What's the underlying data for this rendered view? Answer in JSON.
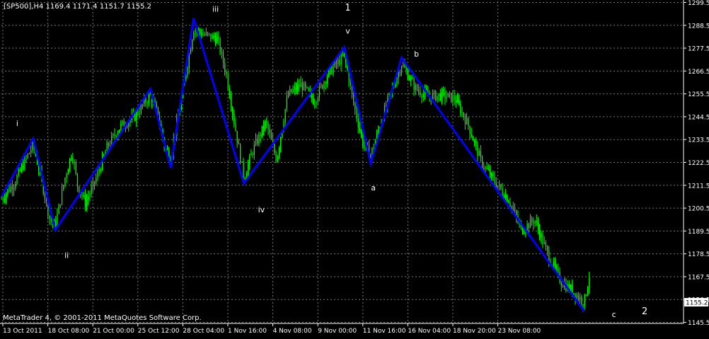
{
  "header": {
    "text": "[SP500],H4  1169.4 1171.4 1151.7 1155.2"
  },
  "copyright": "MetaTrader 4, © 2001-2011 MetaQuotes Software Corp.",
  "colors": {
    "background": "#000000",
    "grid": "#6e7f6e",
    "candles": "#00ff00",
    "wave_line": "#0000ff",
    "text": "#ffffff",
    "price_tag_bg": "#ffffff"
  },
  "chart_data": {
    "type": "line",
    "symbol": "[SP500],H4",
    "ohlc": {
      "open": 1169.4,
      "high": 1171.4,
      "low": 1151.7,
      "close": 1155.2
    },
    "current_price_label": "1155.2",
    "ylim": [
      1145.0,
      1300.0
    ],
    "y_ticks": [
      "1299.5",
      "1288.5",
      "1277.5",
      "1266.5",
      "1255.5",
      "1244.5",
      "1233.5",
      "1222.5",
      "1211.5",
      "1200.5",
      "1189.5",
      "1178.5",
      "1167.5",
      "1156.5",
      "1145.5"
    ],
    "x_ticks": [
      "13 Oct 2011",
      "18 Oct 08:00",
      "21 Oct 00:00",
      "25 Oct 12:00",
      "28 Oct 04:00",
      "1 Nov 16:00",
      "4 Nov 08:00",
      "9 Nov 00:00",
      "11 Nov 16:00",
      "16 Nov 04:00",
      "18 Nov 20:00",
      "23 Nov 08:00"
    ],
    "grid": true,
    "wave_series": {
      "name": "wave count",
      "points": [
        {
          "t": 0.0,
          "y": 1206.0
        },
        {
          "t": 3.6,
          "y": 1234.0
        },
        {
          "t": 6.1,
          "y": 1190.0
        },
        {
          "t": 16.9,
          "y": 1258.0
        },
        {
          "t": 19.2,
          "y": 1220.0
        },
        {
          "t": 21.8,
          "y": 1292.0
        },
        {
          "t": 27.5,
          "y": 1212.5
        },
        {
          "t": 38.9,
          "y": 1278.0
        },
        {
          "t": 41.9,
          "y": 1222.0
        },
        {
          "t": 45.4,
          "y": 1273.0
        },
        {
          "t": 66.1,
          "y": 1151.0
        }
      ]
    },
    "price_path": [
      {
        "t": 0.0,
        "y": 1205.0
      },
      {
        "t": 1.5,
        "y": 1213.0
      },
      {
        "t": 3.6,
        "y": 1231.0
      },
      {
        "t": 4.5,
        "y": 1215.0
      },
      {
        "t": 5.5,
        "y": 1195.0
      },
      {
        "t": 6.1,
        "y": 1192.0
      },
      {
        "t": 7.2,
        "y": 1215.0
      },
      {
        "t": 8.0,
        "y": 1228.0
      },
      {
        "t": 8.6,
        "y": 1212.0
      },
      {
        "t": 9.5,
        "y": 1203.0
      },
      {
        "t": 10.5,
        "y": 1212.0
      },
      {
        "t": 12.0,
        "y": 1230.0
      },
      {
        "t": 13.5,
        "y": 1240.0
      },
      {
        "t": 15.0,
        "y": 1244.0
      },
      {
        "t": 16.9,
        "y": 1255.0
      },
      {
        "t": 17.8,
        "y": 1245.0
      },
      {
        "t": 18.5,
        "y": 1230.0
      },
      {
        "t": 19.2,
        "y": 1225.0
      },
      {
        "t": 20.5,
        "y": 1255.0
      },
      {
        "t": 21.8,
        "y": 1287.0
      },
      {
        "t": 23.0,
        "y": 1284.0
      },
      {
        "t": 24.5,
        "y": 1282.0
      },
      {
        "t": 25.5,
        "y": 1265.0
      },
      {
        "t": 26.5,
        "y": 1240.0
      },
      {
        "t": 27.5,
        "y": 1215.0
      },
      {
        "t": 28.5,
        "y": 1228.0
      },
      {
        "t": 30.0,
        "y": 1242.0
      },
      {
        "t": 31.2,
        "y": 1224.0
      },
      {
        "t": 32.5,
        "y": 1255.0
      },
      {
        "t": 34.0,
        "y": 1260.0
      },
      {
        "t": 35.5,
        "y": 1252.0
      },
      {
        "t": 37.0,
        "y": 1265.0
      },
      {
        "t": 38.9,
        "y": 1274.0
      },
      {
        "t": 40.0,
        "y": 1250.0
      },
      {
        "t": 41.0,
        "y": 1232.0
      },
      {
        "t": 41.9,
        "y": 1226.0
      },
      {
        "t": 43.5,
        "y": 1248.0
      },
      {
        "t": 45.4,
        "y": 1270.0
      },
      {
        "t": 47.0,
        "y": 1258.0
      },
      {
        "t": 48.5,
        "y": 1254.0
      },
      {
        "t": 50.0,
        "y": 1255.0
      },
      {
        "t": 51.5,
        "y": 1253.0
      },
      {
        "t": 53.0,
        "y": 1240.0
      },
      {
        "t": 54.5,
        "y": 1222.0
      },
      {
        "t": 56.0,
        "y": 1213.0
      },
      {
        "t": 57.5,
        "y": 1205.0
      },
      {
        "t": 59.0,
        "y": 1190.0
      },
      {
        "t": 60.5,
        "y": 1195.0
      },
      {
        "t": 62.0,
        "y": 1178.0
      },
      {
        "t": 63.5,
        "y": 1165.0
      },
      {
        "t": 65.0,
        "y": 1160.0
      },
      {
        "t": 66.1,
        "y": 1155.0
      },
      {
        "t": 66.7,
        "y": 1168.0
      }
    ],
    "n_bars": 67,
    "annotations": [
      {
        "text": "i",
        "t": 1.8,
        "y": 1240.0
      },
      {
        "text": "ii",
        "t": 7.4,
        "y": 1176.5
      },
      {
        "text": "iii",
        "t": 24.3,
        "y": 1295.0
      },
      {
        "text": "iv",
        "t": 29.5,
        "y": 1198.5
      },
      {
        "text": "1",
        "t": 39.3,
        "y": 1295.5
      },
      {
        "text": "v",
        "t": 39.3,
        "y": 1284.5
      },
      {
        "text": "a",
        "t": 42.2,
        "y": 1209.0
      },
      {
        "text": "b",
        "t": 47.1,
        "y": 1273.5
      },
      {
        "text": "c",
        "t": 69.5,
        "y": 1148.0
      },
      {
        "text": "2",
        "t": 73.0,
        "y": 1149.5
      }
    ]
  }
}
